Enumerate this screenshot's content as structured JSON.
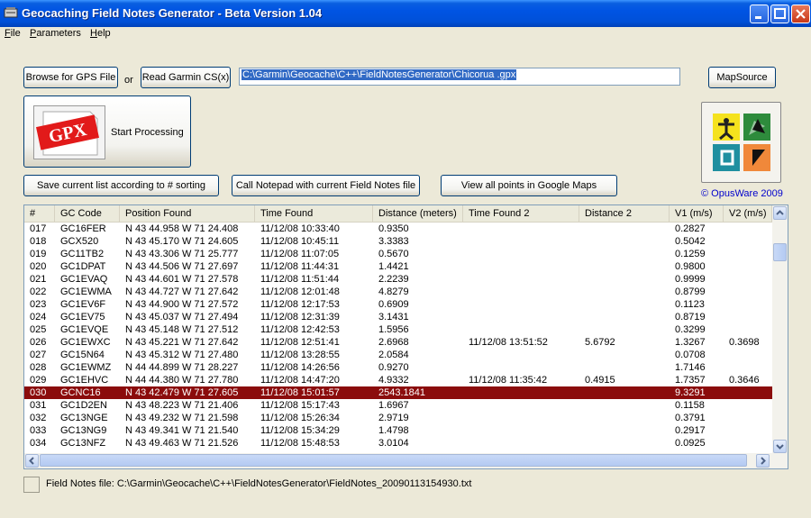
{
  "window": {
    "title": "Geocaching Field Notes Generator - Beta Version 1.04",
    "accent": "#0054e3"
  },
  "menu": [
    "File",
    "Parameters",
    "Help"
  ],
  "toolbar": {
    "browse_label": "Browse for GPS File",
    "or_label": "or",
    "read_garmin_label": "Read Garmin CS(x)",
    "path_value": "C:\\Garmin\\Geocache\\C++\\FieldNotesGenerator\\Chicorua .gpx",
    "mapsource_label": "MapSource",
    "start_label": "Start Processing",
    "gpx_badge": "GPX",
    "save_list_label": "Save current list according to # sorting",
    "call_notepad_label": "Call Notepad with current  Field Notes file",
    "view_maps_label": "View all points in Google Maps",
    "copyright": "© OpusWare 2009"
  },
  "table": {
    "columns": [
      "#",
      "GC Code",
      "Position Found",
      "Time Found",
      "Distance (meters)",
      "Time Found 2",
      "Distance 2",
      "V1 (m/s)",
      "V2 (m/s)"
    ],
    "selected_color": "#8b0c0c",
    "rows": [
      [
        "017",
        "GC16FER",
        "N 43 44.958 W 71 24.408",
        "11/12/08 10:33:40",
        "0.9350",
        "",
        "",
        "0.2827",
        ""
      ],
      [
        "018",
        "GCX520",
        "N 43 45.170 W 71 24.605",
        "11/12/08 10:45:11",
        "3.3383",
        "",
        "",
        "0.5042",
        ""
      ],
      [
        "019",
        "GC11TB2",
        "N 43 43.306 W 71 25.777",
        "11/12/08 11:07:05",
        "0.5670",
        "",
        "",
        "0.1259",
        ""
      ],
      [
        "020",
        "GC1DPAT",
        "N 43 44.506 W 71 27.697",
        "11/12/08 11:44:31",
        "1.4421",
        "",
        "",
        "0.9800",
        ""
      ],
      [
        "021",
        "GC1EVAQ",
        "N 43 44.601 W 71 27.578",
        "11/12/08 11:51:44",
        "2.2239",
        "",
        "",
        "0.9999",
        ""
      ],
      [
        "022",
        "GC1EWMA",
        "N 43 44.727 W 71 27.642",
        "11/12/08 12:01:48",
        "4.8279",
        "",
        "",
        "0.8799",
        ""
      ],
      [
        "023",
        "GC1EV6F",
        "N 43 44.900 W 71 27.572",
        "11/12/08 12:17:53",
        "0.6909",
        "",
        "",
        "0.1123",
        ""
      ],
      [
        "024",
        "GC1EV75",
        "N 43 45.037 W 71 27.494",
        "11/12/08 12:31:39",
        "3.1431",
        "",
        "",
        "0.8719",
        ""
      ],
      [
        "025",
        "GC1EVQE",
        "N 43 45.148 W 71 27.512",
        "11/12/08 12:42:53",
        "1.5956",
        "",
        "",
        "0.3299",
        ""
      ],
      [
        "026",
        "GC1EWXC",
        "N 43 45.221 W 71 27.642",
        "11/12/08 12:51:41",
        "2.6968",
        "11/12/08 13:51:52",
        "5.6792",
        "1.3267",
        "0.3698"
      ],
      [
        "027",
        "GC15N64",
        "N 43 45.312 W 71 27.480",
        "11/12/08 13:28:55",
        "2.0584",
        "",
        "",
        "0.0708",
        ""
      ],
      [
        "028",
        "GC1EWMZ",
        "N 44 44.899 W 71 28.227",
        "11/12/08 14:26:56",
        "0.9270",
        "",
        "",
        "1.7146",
        ""
      ],
      [
        "029",
        "GC1EHVC",
        "N 44 44.380 W 71 27.780",
        "11/12/08 14:47:20",
        "4.9332",
        "11/12/08 11:35:42",
        "0.4915",
        "1.7357",
        "0.3646"
      ],
      [
        "030",
        "GCNC16",
        "N 43 42.479 W 71 27.605",
        "11/12/08 15:01:57",
        "2543.1841",
        "",
        "",
        "9.3291",
        ""
      ],
      [
        "031",
        "GC1D2EN",
        "N 43 48.223 W 71 21.406",
        "11/12/08 15:17:43",
        "1.6967",
        "",
        "",
        "0.1158",
        ""
      ],
      [
        "032",
        "GC13NGE",
        "N 43 49.232 W 71 21.598",
        "11/12/08 15:26:34",
        "2.9719",
        "",
        "",
        "0.3791",
        ""
      ],
      [
        "033",
        "GC13NG9",
        "N 43 49.341 W 71 21.540",
        "11/12/08 15:34:29",
        "1.4798",
        "",
        "",
        "0.2917",
        ""
      ],
      [
        "034",
        "GC13NFZ",
        "N 43 49.463 W 71 21.526",
        "11/12/08 15:48:53",
        "3.0104",
        "",
        "",
        "0.0925",
        ""
      ]
    ]
  },
  "status": {
    "field_notes_file": "Field Notes file: C:\\Garmin\\Geocache\\C++\\FieldNotesGenerator\\FieldNotes_20090113154930.txt"
  }
}
